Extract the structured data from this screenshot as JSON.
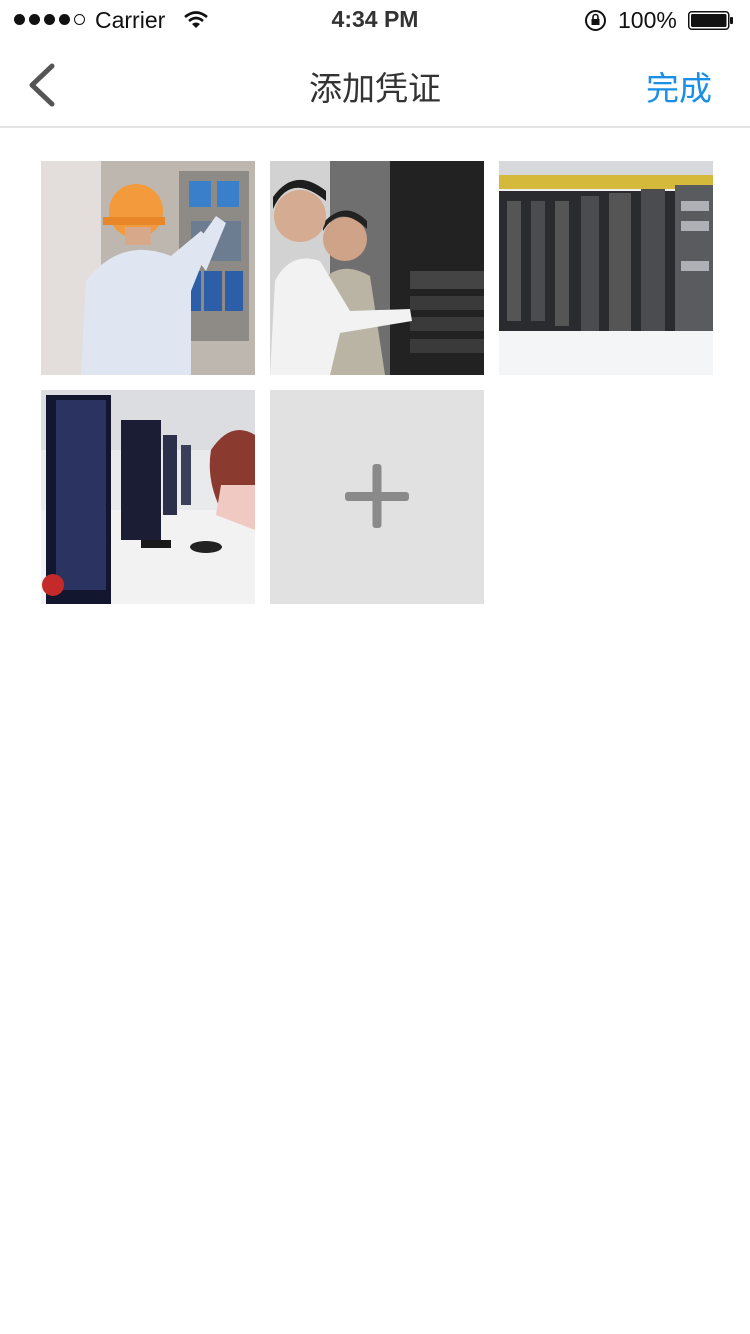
{
  "status_bar": {
    "carrier": "Carrier",
    "time": "4:34 PM",
    "battery": "100%"
  },
  "nav": {
    "title": "添加凭证",
    "done_label": "完成"
  },
  "photos": [
    {
      "name": "technician-at-control-panel"
    },
    {
      "name": "men-at-server-rack"
    },
    {
      "name": "server-room-racks"
    },
    {
      "name": "woman-at-computer-lab"
    }
  ],
  "add_button": {
    "icon": "plus-icon"
  },
  "colors": {
    "accent": "#1a8fe6",
    "add_tile_bg": "#e1e1e1",
    "divider": "#e3e3e3"
  }
}
